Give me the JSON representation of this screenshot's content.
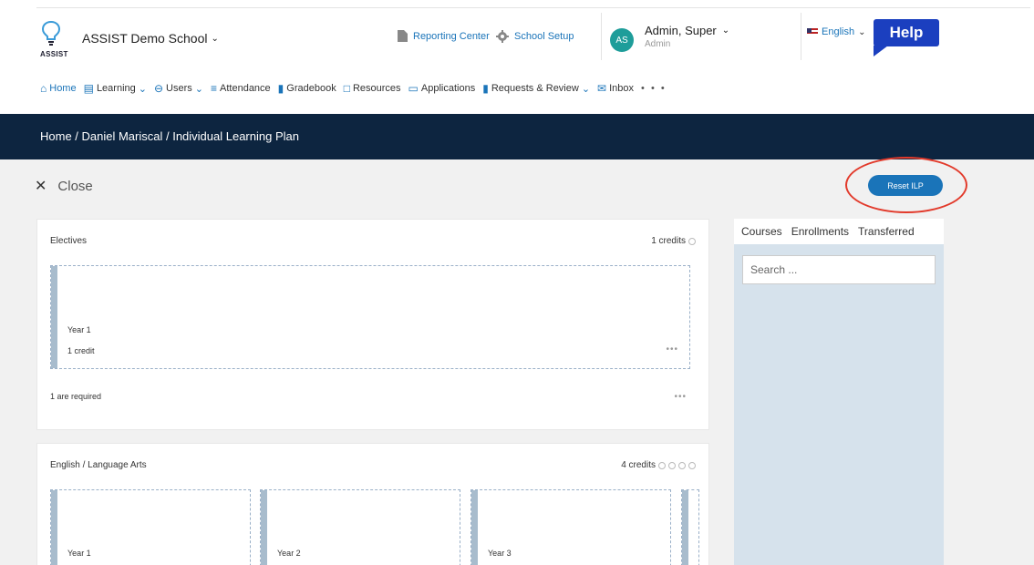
{
  "header": {
    "logo_text": "ASSIST",
    "school_name": "ASSIST Demo School",
    "reporting_center": "Reporting Center",
    "school_setup": "School Setup",
    "avatar_initials": "AS",
    "user_name": "Admin, Super",
    "user_role": "Admin",
    "language": "English",
    "help_label": "Help"
  },
  "nav": {
    "items": [
      {
        "label": "Home",
        "icon": "home-icon"
      },
      {
        "label": "Learning",
        "icon": "learning-icon"
      },
      {
        "label": "Users",
        "icon": "users-icon"
      },
      {
        "label": "Attendance",
        "icon": "attendance-icon"
      },
      {
        "label": "Gradebook",
        "icon": "gradebook-icon"
      },
      {
        "label": "Resources",
        "icon": "resources-icon"
      },
      {
        "label": "Applications",
        "icon": "applications-icon"
      },
      {
        "label": "Requests & Review",
        "icon": "requests-icon"
      },
      {
        "label": "Inbox",
        "icon": "inbox-icon"
      }
    ],
    "more": "• • •"
  },
  "breadcrumb": "Home / Daniel Mariscal / Individual Learning Plan",
  "content": {
    "close_label": "Close",
    "reset_label": "Reset ILP"
  },
  "electives": {
    "title": "Electives",
    "credits": "1 credits",
    "slot_year": "Year 1",
    "slot_credit": "1 credit",
    "required": "1 are required"
  },
  "english": {
    "title": "English / Language Arts",
    "credits": "4 credits",
    "slots": [
      {
        "year": "Year 1"
      },
      {
        "year": "Year 2"
      },
      {
        "year": "Year 3"
      }
    ]
  },
  "panel": {
    "tabs": [
      "Courses",
      "Enrollments",
      "Transferred"
    ],
    "search_placeholder": "Search ..."
  },
  "colors": {
    "primary": "#1a74b9",
    "header_band": "#0d2540",
    "highlight": "#e23a2b"
  }
}
